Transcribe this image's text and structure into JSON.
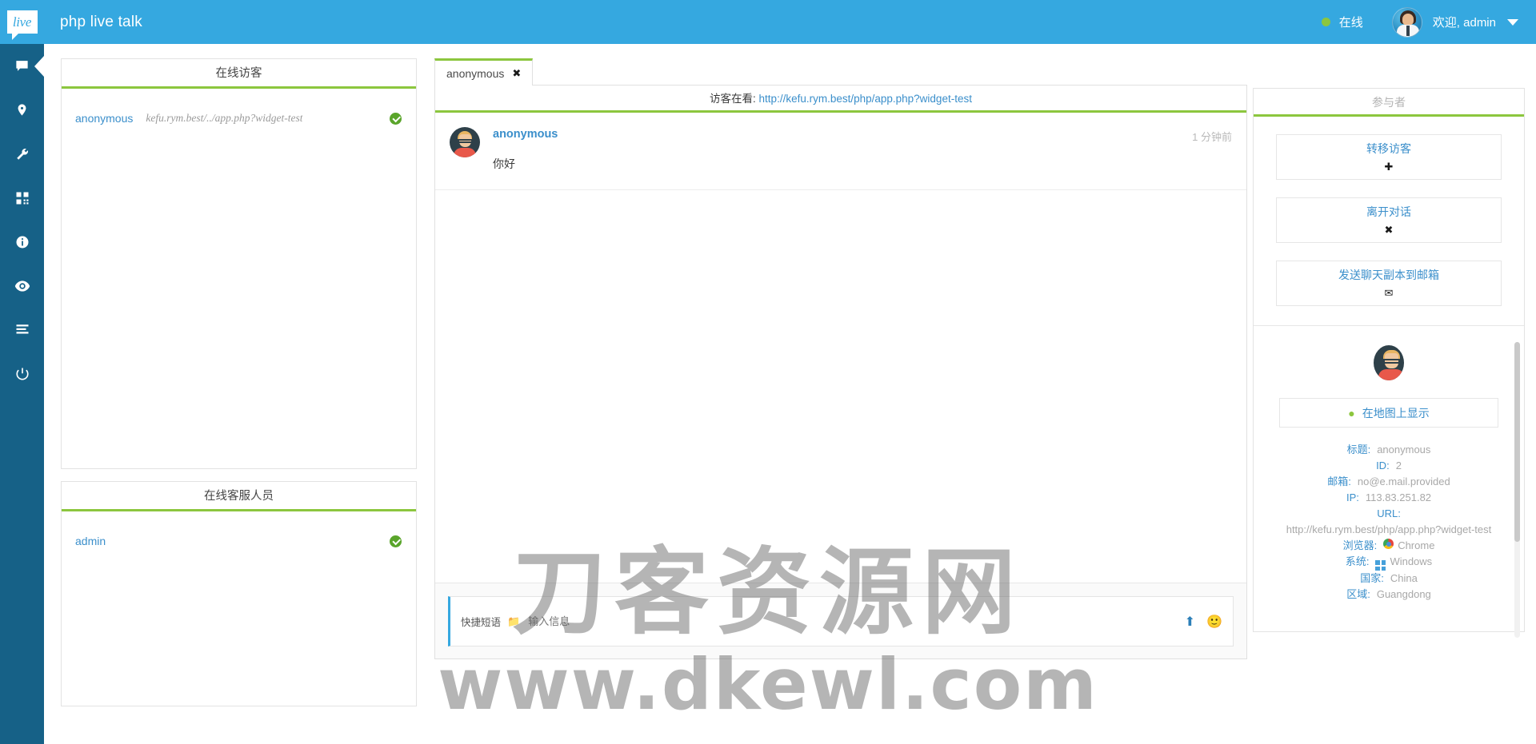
{
  "header": {
    "logo_text": "live",
    "app_title": "php live talk",
    "status_label": "在线",
    "welcome_label": "欢迎, admin",
    "accent_color": "#35a8e0",
    "status_color": "#8cc63e"
  },
  "rail": {
    "items": [
      {
        "icon": "chat-icon",
        "active": true
      },
      {
        "icon": "map-pin-icon",
        "active": false
      },
      {
        "icon": "wrench-icon",
        "active": false
      },
      {
        "icon": "qrcode-icon",
        "active": false
      },
      {
        "icon": "info-circle-icon",
        "active": false
      },
      {
        "icon": "eye-icon",
        "active": false
      },
      {
        "icon": "list-bars-icon",
        "active": false
      },
      {
        "icon": "power-icon",
        "active": false
      }
    ]
  },
  "visitors_panel": {
    "title": "在线访客",
    "rows": [
      {
        "name": "anonymous",
        "url": "kefu.rym.best/../app.php?widget-test",
        "status": "online"
      }
    ]
  },
  "operators_panel": {
    "title": "在线客服人员",
    "rows": [
      {
        "name": "admin",
        "status": "online"
      }
    ]
  },
  "chat": {
    "tab_label": "anonymous",
    "tab_close": "✖",
    "url_label": "访客在看:",
    "url_value": "http://kefu.rym.best/php/app.php?widget-test",
    "messages": [
      {
        "author": "anonymous",
        "time": "1 分钟前",
        "text": "你好"
      }
    ],
    "composer": {
      "quick_label": "快捷短语",
      "folder_icon": "📁",
      "placeholder": "输入信息",
      "value": "",
      "upload_icon": "⬆",
      "emoji_icon": "🙂"
    }
  },
  "right_panel": {
    "title": "参与者",
    "actions": [
      {
        "label": "转移访客",
        "glyph": "✚",
        "name": "transfer-visitor"
      },
      {
        "label": "离开对话",
        "glyph": "✖",
        "name": "leave-chat"
      },
      {
        "label": "发送聊天副本到邮箱",
        "glyph": "✉",
        "name": "email-transcript"
      }
    ],
    "map_button": "在地图上显示",
    "info": [
      {
        "key": "标题:",
        "value": "anonymous"
      },
      {
        "key": "ID:",
        "value": "2"
      },
      {
        "key": "邮箱:",
        "value": "no@e.mail.provided"
      },
      {
        "key": "IP:",
        "value": "113.83.251.82"
      }
    ],
    "url_key": "URL:",
    "url_value": "http://kefu.rym.best/php/app.php?widget-test",
    "browser_key": "浏览器:",
    "browser_value": "Chrome",
    "os_key": "系统:",
    "os_value": "Windows",
    "country_key": "国家:",
    "country_value": "China",
    "region_key": "区域:",
    "region_value": "Guangdong"
  },
  "watermark": {
    "line1": "刀客资源网",
    "line2": "www.dkewl.com"
  }
}
